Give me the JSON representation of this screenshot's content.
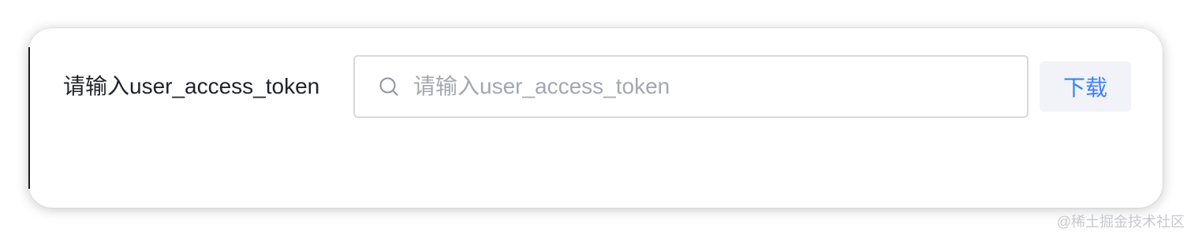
{
  "form": {
    "label": "请输入user_access_token",
    "input": {
      "value": "",
      "placeholder": "请输入user_access_token",
      "icon": "search-icon"
    },
    "download_label": "下载"
  },
  "watermark": "@稀土掘金技术社区",
  "colors": {
    "button_text": "#3b82f6",
    "button_bg": "#f1f3f8",
    "input_border": "#d6d8de",
    "placeholder": "#a3a7b0"
  }
}
